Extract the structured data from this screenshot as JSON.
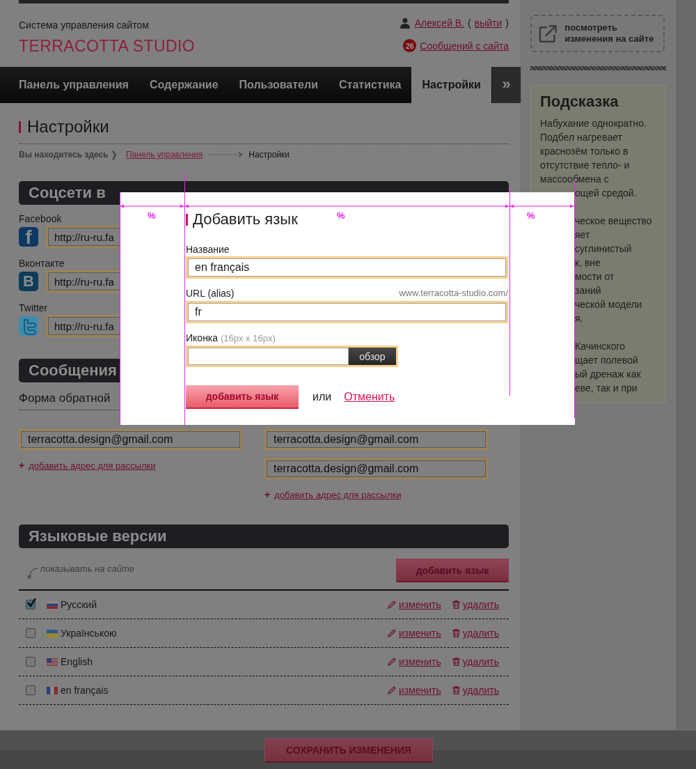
{
  "header": {
    "system_title": "Система управления сайтом",
    "logo": "TERRACOTTA STUDIO",
    "user": {
      "name": "Алексей В.",
      "open_paren": "(",
      "logout": "выйти",
      "close_paren": ")"
    },
    "messages": {
      "count": "26",
      "label": "Сообщений с сайта"
    }
  },
  "nav": {
    "tabs": [
      {
        "label": "Панель управления",
        "selected": false
      },
      {
        "label": "Содержание",
        "selected": false
      },
      {
        "label": "Пользователи",
        "selected": false
      },
      {
        "label": "Статистика",
        "selected": false
      },
      {
        "label": "Настройки",
        "selected": true
      }
    ],
    "more": "»"
  },
  "page_title": "Настройки",
  "breadcrumb": {
    "prefix": "Вы находитесь здесь ❭",
    "link": "Панель управления",
    "current": "Настройки"
  },
  "social": {
    "heading": "Соцсети в",
    "items": [
      {
        "kind": "facebook",
        "glyph": "f",
        "label": "Facebook",
        "value": "http://ru-ru.fa"
      },
      {
        "kind": "vk",
        "glyph": "B",
        "label": "Вконтакте",
        "value": "http://ru-ru.fa"
      },
      {
        "kind": "twitter",
        "label": "Twitter",
        "value": "http://ru-ru.fa"
      }
    ]
  },
  "messages_section": {
    "heading": "Сообщения",
    "form_title": "Форма обратной",
    "columns": [
      {
        "emails": [
          "terracotta.design@gmail.com"
        ],
        "plus": "+",
        "add_link": "добавить адрес для рассылки"
      },
      {
        "emails": [
          "terracotta.design@gmail.com",
          "terracotta.design@gmail.com"
        ],
        "plus": "+",
        "add_link": "добавить адрес для рассылки"
      }
    ]
  },
  "languages": {
    "heading": "Языковые версии",
    "hint": "показывать на сайте",
    "add_button": "добавить язык",
    "rows": [
      {
        "name": "Русский",
        "kind": "ru",
        "checked": true,
        "edit": "изменить",
        "delete": "удалить"
      },
      {
        "name": "Українською",
        "kind": "ua",
        "checked": false,
        "edit": "изменить",
        "delete": "удалить"
      },
      {
        "name": "English",
        "kind": "us",
        "checked": false,
        "edit": "изменить",
        "delete": "удалить"
      },
      {
        "name": "en français",
        "kind": "fr",
        "checked": false,
        "edit": "изменить",
        "delete": "удалить"
      }
    ]
  },
  "save_button": "СОХРАНИТЬ ИЗМЕНЕНИЯ",
  "sidebar": {
    "preview_link": "посмотреть изменения на сайте",
    "hint": {
      "title": "Подсказка",
      "lines": [
        "Набухание однократно.",
        "Подбел нагревает",
        "краснозём только в",
        "отсутствие тепло- и",
        "массообмена с"
      ],
      "cut_paragraphs": [
        [
          "ощей средой."
        ],
        [
          "ческое вещество",
          "яет",
          "суглинистый",
          "к, вне",
          "мости от",
          "заний",
          "ческой модели",
          "я."
        ],
        [
          "Качинского",
          "щает полевой",
          "ый дренаж как",
          "еве, так и при"
        ]
      ]
    }
  },
  "dialog": {
    "title": "Добавить язык",
    "name": {
      "label": "Название",
      "value": "en français"
    },
    "url": {
      "label": "URL (alias)",
      "prefix": "www.terracotta-studio.com/",
      "value": "fr"
    },
    "icon": {
      "label": "Иконка",
      "hint": "(16px x 16px)",
      "browse": "обзор"
    },
    "submit": "добавить язык",
    "or": "или",
    "cancel": "Отменить",
    "guides": [
      "%",
      "%",
      "%"
    ]
  }
}
